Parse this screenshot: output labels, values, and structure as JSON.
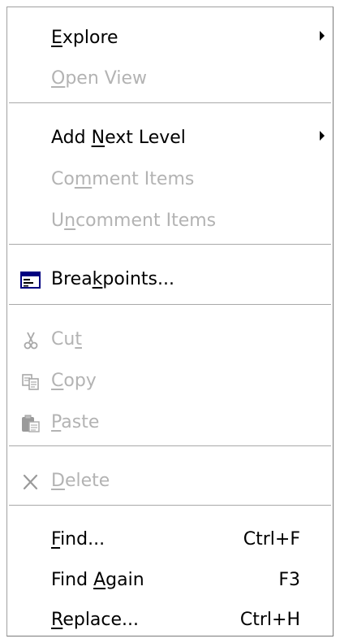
{
  "menu": {
    "explore": {
      "label": [
        "",
        "E",
        "xplore"
      ]
    },
    "open_view": {
      "label": [
        "",
        "O",
        "pen View"
      ]
    },
    "add_next_level": {
      "label": [
        "Add ",
        "N",
        "ext Level"
      ]
    },
    "comment_items": {
      "label": [
        "Co",
        "m",
        "ment Items"
      ]
    },
    "uncomment_items": {
      "label": [
        "U",
        "n",
        "comment Items"
      ]
    },
    "breakpoints": {
      "label": [
        "Brea",
        "k",
        "points..."
      ]
    },
    "cut": {
      "label": [
        "Cu",
        "t",
        ""
      ]
    },
    "copy": {
      "label": [
        "",
        "C",
        "opy"
      ]
    },
    "paste": {
      "label": [
        "",
        "P",
        "aste"
      ]
    },
    "delete": {
      "label": [
        "",
        "D",
        "elete"
      ]
    },
    "find": {
      "label": [
        "",
        "F",
        "ind..."
      ],
      "shortcut": "Ctrl+F"
    },
    "find_again": {
      "label": [
        "Find ",
        "A",
        "gain"
      ],
      "shortcut": "F3"
    },
    "replace": {
      "label": [
        "",
        "R",
        "eplace..."
      ],
      "shortcut": "Ctrl+H"
    }
  },
  "icons": {
    "breakpoints": "window-list-icon",
    "cut": "scissors-icon",
    "copy": "copy-pages-icon",
    "paste": "clipboard-icon",
    "delete": "x-delete-icon"
  },
  "colors": {
    "enabled_text": "#000000",
    "disabled_text": "#b3b3b3",
    "separator": "#a9a9a9"
  }
}
